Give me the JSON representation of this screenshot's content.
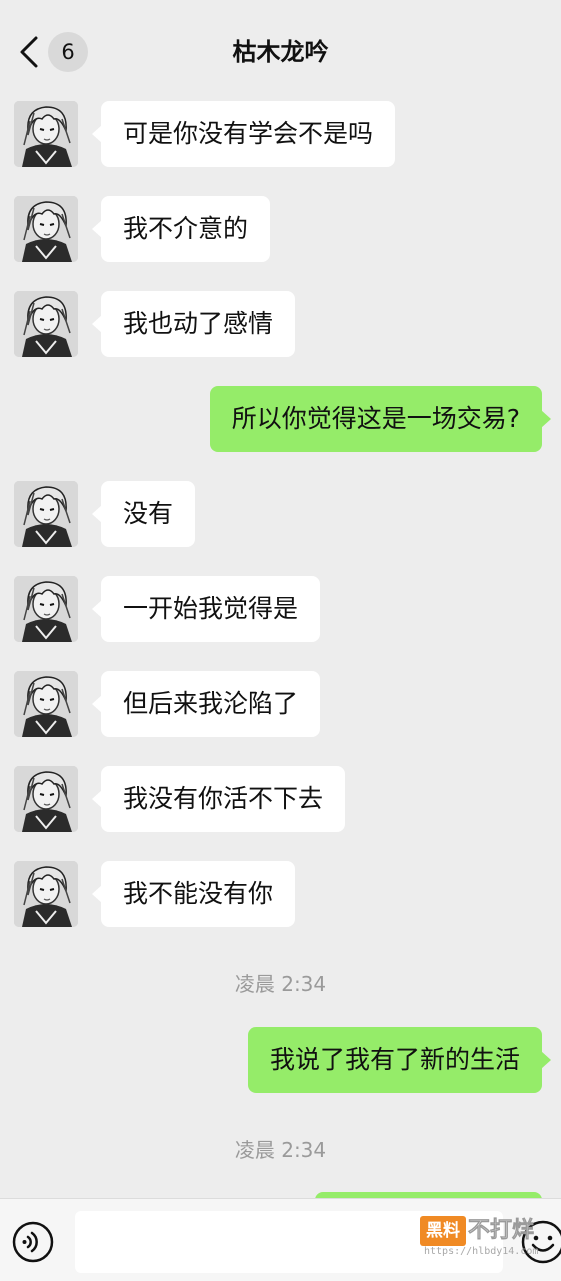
{
  "header": {
    "back_badge": "6",
    "title": "枯木龙吟"
  },
  "messages": [
    {
      "side": "left",
      "text": "可是你没有学会不是吗"
    },
    {
      "side": "left",
      "text": "我不介意的"
    },
    {
      "side": "left",
      "text": "我也动了感情"
    },
    {
      "side": "right",
      "text": "所以你觉得这是一场交易?"
    },
    {
      "side": "left",
      "text": "没有"
    },
    {
      "side": "left",
      "text": "一开始我觉得是"
    },
    {
      "side": "left",
      "text": "但后来我沦陷了"
    },
    {
      "side": "left",
      "text": "我没有你活不下去"
    },
    {
      "side": "left",
      "text": "我不能没有你"
    },
    {
      "side": "time",
      "text": "凌晨 2:34"
    },
    {
      "side": "right",
      "text": "我说了我有了新的生活"
    },
    {
      "side": "time",
      "text": "凌晨 2:34"
    }
  ],
  "input_bar": {
    "voice_icon": "voice-icon",
    "emoji_icon": "emoji-icon",
    "text_value": ""
  },
  "watermark": {
    "badge": "黑料",
    "text": "不打烊",
    "url": "https://hlbdy14.com"
  },
  "colors": {
    "background": "#ededed",
    "incoming_bubble": "#ffffff",
    "outgoing_bubble": "#95ec69",
    "timestamp": "#9a9a9a"
  }
}
